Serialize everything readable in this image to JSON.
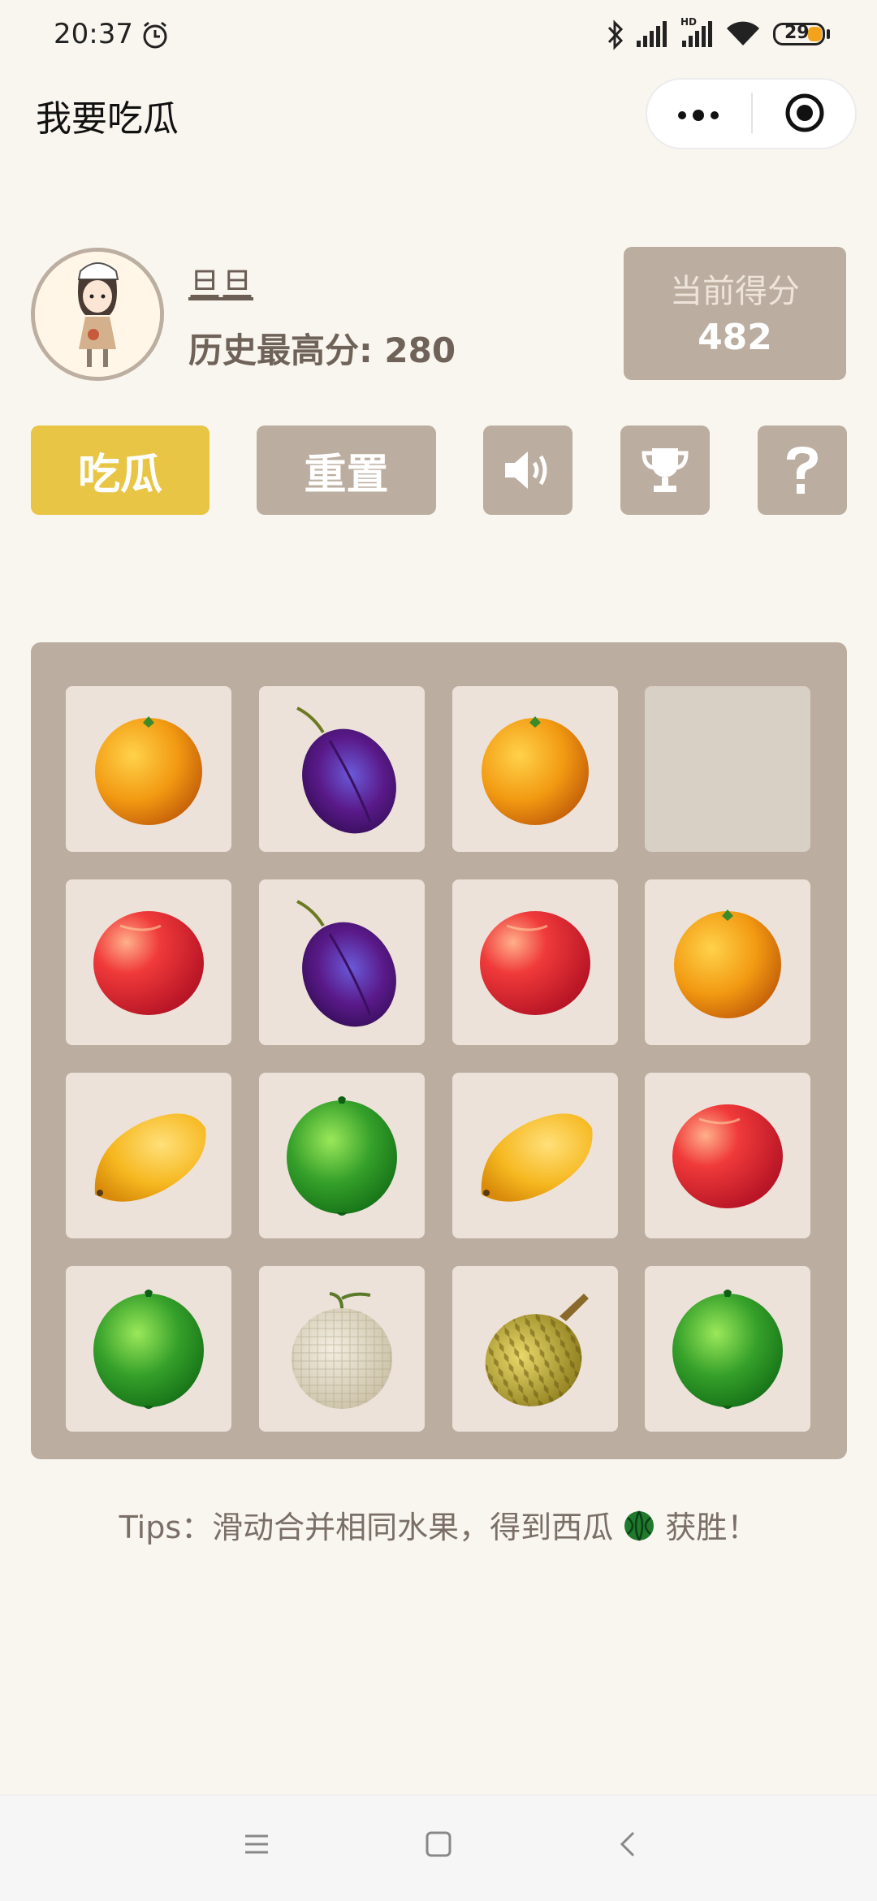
{
  "status_bar": {
    "time": "20:37",
    "battery": "29",
    "network_label": "HD"
  },
  "header": {
    "title": "我要吃瓜"
  },
  "profile": {
    "username": "旦旦",
    "best_score_label": "历史最高分: ",
    "best_score": "280"
  },
  "score": {
    "label": "当前得分",
    "value": "482"
  },
  "buttons": {
    "eat": "吃瓜",
    "reset": "重置"
  },
  "board": {
    "rows": [
      [
        "orange",
        "plum",
        "orange",
        "empty"
      ],
      [
        "peach",
        "plum",
        "peach",
        "orange"
      ],
      [
        "mango",
        "lime",
        "mango",
        "peach"
      ],
      [
        "lime",
        "cantaloupe",
        "durian",
        "lime"
      ]
    ]
  },
  "tips": {
    "text_before": "Tips：滑动合并相同水果，得到西瓜",
    "text_after": "获胜！"
  },
  "colors": {
    "board": "#bbada0",
    "tile": "#ede2d9",
    "eat_button": "#e8c544",
    "background": "#f9f6ef"
  }
}
